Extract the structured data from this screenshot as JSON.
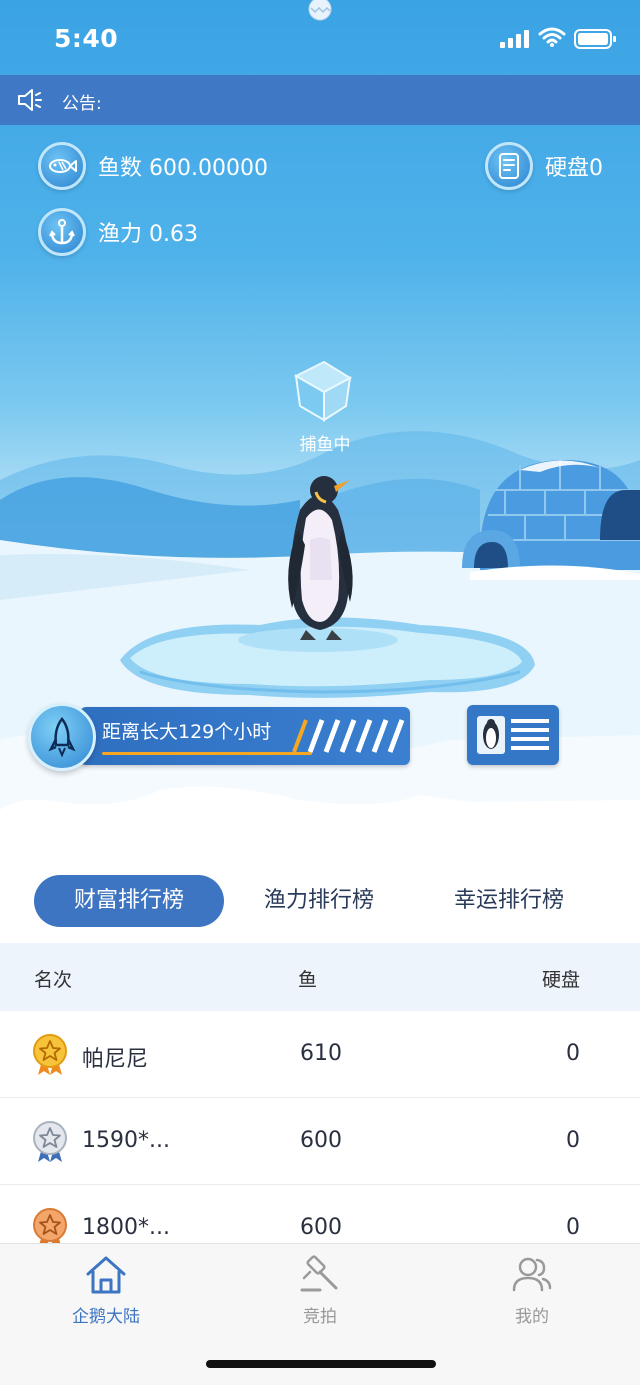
{
  "status_bar": {
    "time": "5:40"
  },
  "notice": {
    "label": "公告:"
  },
  "stats": {
    "fish": "鱼数 600.00000",
    "fishing_power": "渔力 0.63",
    "disk": "硬盘0"
  },
  "scene": {
    "catching_label": "捕鱼中"
  },
  "growth": {
    "text": "距离长大129个小时",
    "progress": 0.6
  },
  "ranking": {
    "tabs": [
      {
        "label": "财富排行榜",
        "active": true
      },
      {
        "label": "渔力排行榜",
        "active": false
      },
      {
        "label": "幸运排行榜",
        "active": false
      }
    ],
    "columns": [
      "名次",
      "鱼",
      "硬盘"
    ],
    "rows": [
      {
        "name": "帕尼尼",
        "fish": "610",
        "disk": "0",
        "medal": "gold"
      },
      {
        "name": "1590*...",
        "fish": "600",
        "disk": "0",
        "medal": "silver"
      },
      {
        "name": "1800*...",
        "fish": "600",
        "disk": "0",
        "medal": "bronze"
      }
    ]
  },
  "nav": [
    {
      "label": "企鹅大陆",
      "icon": "home-icon",
      "active": true
    },
    {
      "label": "竞拍",
      "icon": "gavel-icon",
      "active": false
    },
    {
      "label": "我的",
      "icon": "user-icon",
      "active": false
    }
  ],
  "colors": {
    "primary": "#3d75c3",
    "nav_active": "#3d75c3",
    "nav_inactive": "#999999",
    "progress_accent": "#f5a623"
  }
}
